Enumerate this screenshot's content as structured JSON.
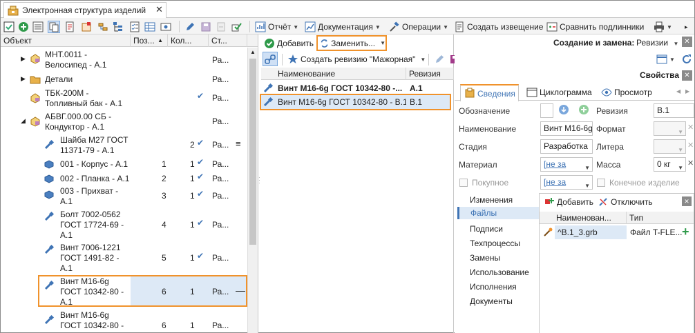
{
  "window": {
    "tab_title": "Электронная структура изделий"
  },
  "toolbar": {
    "report": "Отчёт",
    "documentation": "Документация",
    "operations": "Операции",
    "create_notice": "Создать извещение",
    "compare_originals": "Сравнить подлинники"
  },
  "tree": {
    "headers": {
      "object": "Объект",
      "pos": "Поз...",
      "qty": "Кол...",
      "status": "Ст..."
    },
    "rows": [
      {
        "l1": "МНТ.0011 -",
        "l2": "Велосипед - А.1",
        "pos": "",
        "qty": "",
        "check": "",
        "status": "Ра..."
      },
      {
        "l1": "Детали",
        "l2": "",
        "pos": "",
        "qty": "",
        "check": "",
        "status": "Ра..."
      },
      {
        "l1": "ТБК-200М -",
        "l2": "Топливный бак - А.1",
        "pos": "",
        "qty": "",
        "check": "✔",
        "status": "Ра..."
      },
      {
        "l1": "АБВГ.000.00 СБ -",
        "l2": "Кондуктор - А.1",
        "pos": "",
        "qty": "",
        "check": "",
        "status": "Ра..."
      },
      {
        "l1": "Шайба М27 ГОСТ",
        "l2": "11371-79 - А.1",
        "pos": "",
        "qty": "2",
        "check": "✔",
        "status": "Ра..."
      },
      {
        "l1": "001 - Корпус - А.1",
        "l2": "",
        "pos": "1",
        "qty": "1",
        "check": "✔",
        "status": "Ра..."
      },
      {
        "l1": "002 - Планка - А.1",
        "l2": "",
        "pos": "2",
        "qty": "1",
        "check": "✔",
        "status": "Ра..."
      },
      {
        "l1": "003 - Прихват -",
        "l2": "А.1",
        "pos": "3",
        "qty": "1",
        "check": "✔",
        "status": "Ра..."
      },
      {
        "l1": "Болт 7002-0562",
        "l2": "ГОСТ 17724-69 -",
        "l3": "А.1",
        "pos": "4",
        "qty": "1",
        "check": "✔",
        "status": "Ра..."
      },
      {
        "l1": "Винт 7006-1221",
        "l2": "ГОСТ 1491-82 -",
        "l3": "А.1",
        "pos": "5",
        "qty": "1",
        "check": "✔",
        "status": "Ра..."
      },
      {
        "l1": "Винт М16-6g",
        "l2": "ГОСТ 10342-80 -",
        "l3": "А.1",
        "pos": "6",
        "qty": "1",
        "check": "",
        "status": "Ра..."
      },
      {
        "l1": "Винт М16-6g",
        "l2": "ГОСТ 10342-80 -",
        "l3": "",
        "pos": "6",
        "qty": "1",
        "check": "",
        "status": "Ра..."
      }
    ]
  },
  "middle": {
    "add": "Добавить",
    "replace": "Заменить...",
    "create_revision": "Создать ревизию \"Мажорная\"",
    "col_name": "Наименование",
    "col_revision": "Ревизия",
    "rows": [
      {
        "name": "Винт М16-6g ГОСТ 10342-80 -...",
        "rev": "А.1"
      },
      {
        "name": "Винт М16-6g ГОСТ 10342-80 - В.1",
        "rev": "В.1"
      }
    ]
  },
  "right": {
    "mode_label": "Создание и замена:",
    "mode_value": "Ревизии",
    "properties_title": "Свойства",
    "tabs": [
      "Сведения",
      "Циклограмма",
      "Просмотр"
    ],
    "labels": {
      "designation": "Обозначение",
      "revision": "Ревизия",
      "name": "Наименование",
      "format": "Формат",
      "stage": "Стадия",
      "litera": "Литера",
      "material": "Материал",
      "mass": "Масса",
      "purchased": "Покупное",
      "final_product": "Конечное изделие"
    },
    "values": {
      "revision": "В.1",
      "name": "Винт М16-6g",
      "stage": "Разработка",
      "material": "[не за",
      "mass": "0 кг",
      "purchased_field": "[не за"
    },
    "nav": [
      "Изменения",
      "Файлы",
      "Подписи",
      "Техпроцессы",
      "Замены",
      "Использование",
      "Исполнения",
      "Документы"
    ],
    "files": {
      "add": "Добавить",
      "detach": "Отключить",
      "col_name": "Наименован...",
      "col_type": "Тип",
      "rows": [
        {
          "name": "^В.1_3.grb",
          "type": "Файл T-FLE..."
        }
      ]
    }
  },
  "colors": {
    "highlight": "#f0922b",
    "selection": "#dde9f6",
    "accent": "#3f74b5"
  }
}
